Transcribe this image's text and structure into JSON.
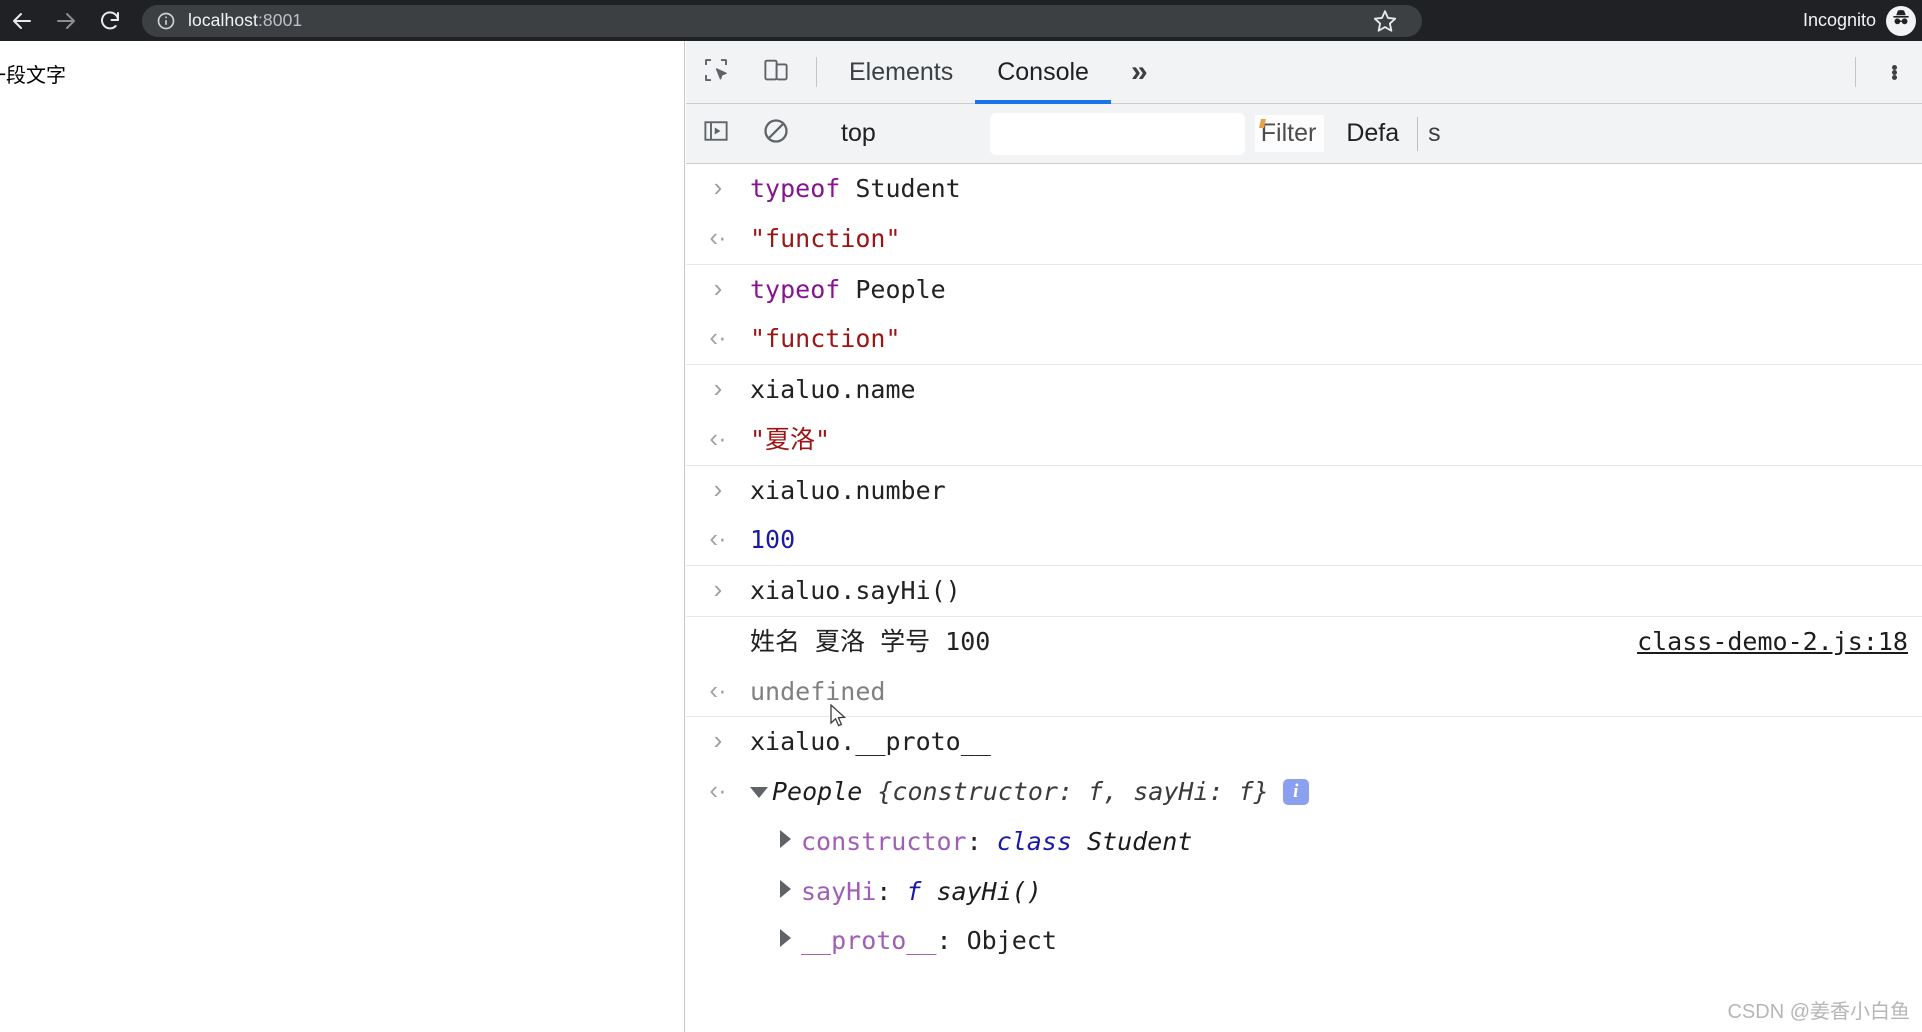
{
  "browser": {
    "back_icon": "arrow-left-icon",
    "forward_icon": "arrow-right-icon",
    "reload_icon": "reload-icon",
    "site_info_icon": "info-circle-icon",
    "url_host": "localhost",
    "url_port": ":8001",
    "bookmark_icon": "star-icon",
    "profile_label": "Incognito",
    "profile_icon": "incognito-hat-icon",
    "chrome_bg": "#202124",
    "omnibox_bg": "#3c4043"
  },
  "page": {
    "text": "一段文字"
  },
  "devtools": {
    "accent": "#1a73e8",
    "inspect_icon": "inspect-element-icon",
    "device_toggle_icon": "device-toolbar-icon",
    "tabs": [
      {
        "label": "Elements",
        "active": false
      },
      {
        "label": "Console",
        "active": true
      }
    ],
    "more_tabs_label": "»",
    "kebab_icon": "more-options-icon",
    "toolbar": {
      "run_icon": "console-sidebar-icon",
      "clear_icon": "clear-console-icon",
      "context_value": "top",
      "filter_value": "",
      "filter_placeholder": "Filter",
      "level_value": "Defa",
      "overflow_glyph": "s"
    }
  },
  "console": {
    "messages": [
      {
        "kind": "input",
        "gutter": "›",
        "separator_above": false,
        "tokens": [
          {
            "cls": "tok-kw",
            "t": "typeof"
          },
          {
            "cls": "tok-plain",
            "t": " Student"
          }
        ]
      },
      {
        "kind": "result",
        "gutter": "‹·",
        "separator_above": false,
        "tokens": [
          {
            "cls": "tok-string",
            "t": "\"function\""
          }
        ]
      },
      {
        "kind": "input",
        "gutter": "›",
        "separator_above": true,
        "tokens": [
          {
            "cls": "tok-kw",
            "t": "typeof"
          },
          {
            "cls": "tok-plain",
            "t": " People"
          }
        ]
      },
      {
        "kind": "result",
        "gutter": "‹·",
        "separator_above": false,
        "tokens": [
          {
            "cls": "tok-string",
            "t": "\"function\""
          }
        ]
      },
      {
        "kind": "input",
        "gutter": "›",
        "separator_above": true,
        "tokens": [
          {
            "cls": "tok-plain",
            "t": "xialuo.name"
          }
        ]
      },
      {
        "kind": "result",
        "gutter": "‹·",
        "separator_above": false,
        "tokens": [
          {
            "cls": "tok-string",
            "t": "\"夏洛\""
          }
        ]
      },
      {
        "kind": "input",
        "gutter": "›",
        "separator_above": true,
        "tokens": [
          {
            "cls": "tok-plain",
            "t": "xialuo.number"
          }
        ]
      },
      {
        "kind": "result",
        "gutter": "‹·",
        "separator_above": false,
        "tokens": [
          {
            "cls": "tok-number",
            "t": "100"
          }
        ]
      },
      {
        "kind": "input",
        "gutter": "›",
        "separator_above": true,
        "tokens": [
          {
            "cls": "tok-plain",
            "t": "xialuo.sayHi()"
          }
        ]
      },
      {
        "kind": "log",
        "gutter": "",
        "separator_above": true,
        "source_link": "class-demo-2.js:18",
        "tokens": [
          {
            "cls": "tok-plain",
            "t": "姓名 夏洛 学号 100"
          }
        ]
      },
      {
        "kind": "result",
        "gutter": "‹·",
        "separator_above": false,
        "tokens": [
          {
            "cls": "tok-undef",
            "t": "undefined"
          }
        ]
      },
      {
        "kind": "input",
        "gutter": "›",
        "separator_above": true,
        "tokens": [
          {
            "cls": "tok-plain",
            "t": "xialuo.__proto__"
          }
        ]
      },
      {
        "kind": "object-head",
        "gutter": "‹·",
        "separator_above": false,
        "expanded": true,
        "badge": "i",
        "tokens": [
          {
            "cls": "tok-objname",
            "t": "People"
          },
          {
            "cls": "tok-objbody",
            "t": " {constructor: f, sayHi: f}"
          }
        ]
      },
      {
        "kind": "property",
        "gutter": "",
        "separator_above": false,
        "tokens": [
          {
            "cls": "tok-prop",
            "t": "constructor"
          },
          {
            "cls": "tok-plain",
            "t": ": "
          },
          {
            "cls": "tok-class",
            "t": "class"
          },
          {
            "cls": "tok-ital",
            "t": " Student"
          }
        ]
      },
      {
        "kind": "property",
        "gutter": "",
        "separator_above": false,
        "tokens": [
          {
            "cls": "tok-prop",
            "t": "sayHi"
          },
          {
            "cls": "tok-plain",
            "t": ": "
          },
          {
            "cls": "tok-fn",
            "t": "f"
          },
          {
            "cls": "tok-ital",
            "t": " sayHi()"
          }
        ]
      },
      {
        "kind": "property",
        "gutter": "",
        "separator_above": false,
        "tokens": [
          {
            "cls": "tok-prop",
            "t": "__proto__"
          },
          {
            "cls": "tok-plain",
            "t": ": Object"
          }
        ]
      }
    ]
  },
  "watermark": {
    "text": "CSDN @姜香小白鱼"
  }
}
